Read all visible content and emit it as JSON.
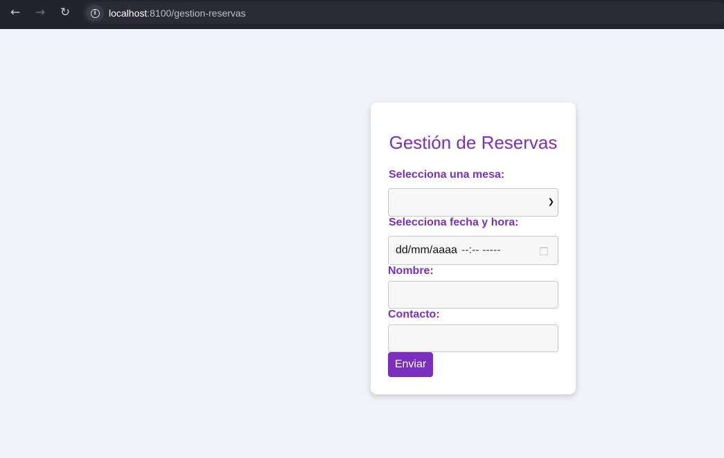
{
  "browser": {
    "url_host": "localhost",
    "url_rest": ":8100/gestion-reservas",
    "back_icon": "arrow-left",
    "forward_icon": "arrow-right",
    "reload_icon": "reload"
  },
  "form": {
    "title": "Gestión de Reservas",
    "table_label": "Selecciona una mesa:",
    "table_value": "",
    "datetime_label": "Selecciona fecha y hora:",
    "date_placeholder": "dd/mm/aaaa",
    "time_placeholder": "--:-- -----",
    "name_label": "Nombre:",
    "name_value": "",
    "contact_label": "Contacto:",
    "contact_value": "",
    "submit_label": "Enviar"
  },
  "colors": {
    "accent": "#7b2fbe",
    "page_background": "#f0f3f8",
    "card_background": "#ffffff",
    "browser_bar": "#23232f"
  }
}
